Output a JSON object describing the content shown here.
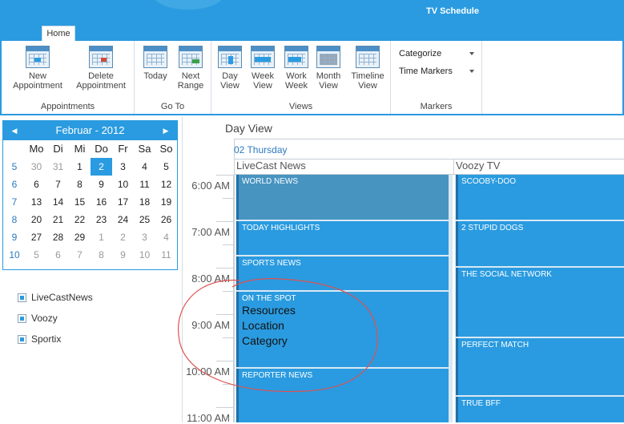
{
  "window": {
    "title": "TV Schedule"
  },
  "ribbon": {
    "tabs": [
      {
        "label": "Home"
      }
    ],
    "groups": [
      {
        "label": "Appointments",
        "buttons": [
          {
            "label": "New\nAppointment",
            "icon": "calendar-new-icon"
          },
          {
            "label": "Delete\nAppointment",
            "icon": "calendar-delete-icon"
          }
        ]
      },
      {
        "label": "Go To",
        "buttons": [
          {
            "label": "Today",
            "icon": "calendar-today-icon"
          },
          {
            "label": "Next\nRange",
            "icon": "calendar-next-icon"
          }
        ]
      },
      {
        "label": "Views",
        "buttons": [
          {
            "label": "Day\nView",
            "icon": "day-view-icon"
          },
          {
            "label": "Week\nView",
            "icon": "week-view-icon"
          },
          {
            "label": "Work\nWeek",
            "icon": "work-week-icon"
          },
          {
            "label": "Month\nView",
            "icon": "month-view-icon"
          },
          {
            "label": "Timeline\nView",
            "icon": "timeline-view-icon"
          }
        ]
      },
      {
        "label": "Markers",
        "dropdowns": [
          {
            "label": "Categorize"
          },
          {
            "label": "Time Markers"
          }
        ]
      }
    ]
  },
  "minicalendar": {
    "month_label": "Februar - 2012",
    "weekday_headers": [
      "Mo",
      "Di",
      "Mi",
      "Do",
      "Fr",
      "Sa",
      "So"
    ],
    "weeks": [
      {
        "week": "5",
        "days": [
          "30",
          "31",
          "1",
          "2",
          "3",
          "4",
          "5"
        ]
      },
      {
        "week": "6",
        "days": [
          "6",
          "7",
          "8",
          "9",
          "10",
          "11",
          "12"
        ]
      },
      {
        "week": "7",
        "days": [
          "13",
          "14",
          "15",
          "16",
          "17",
          "18",
          "19"
        ]
      },
      {
        "week": "8",
        "days": [
          "20",
          "21",
          "22",
          "23",
          "24",
          "25",
          "26"
        ]
      },
      {
        "week": "9",
        "days": [
          "27",
          "28",
          "29",
          "1",
          "2",
          "3",
          "4"
        ]
      },
      {
        "week": "10",
        "days": [
          "5",
          "6",
          "7",
          "8",
          "9",
          "10",
          "11"
        ]
      }
    ],
    "selected_day": "2"
  },
  "resources": [
    "LiveCastNews",
    "Voozy",
    "Sportix"
  ],
  "scheduler": {
    "view_title": "Day View",
    "date_header": "02 Thursday",
    "resource_headers": [
      "LiveCast News",
      "Voozy TV"
    ],
    "time_labels": [
      "6:00 AM",
      "7:00 AM",
      "8:00 AM",
      "9:00 AM",
      "10:00 AM",
      "11:00 AM"
    ],
    "livecast_appointments": [
      {
        "title": "WORLD NEWS"
      },
      {
        "title": "TODAY HIGHLIGHTS"
      },
      {
        "title": "SPORTS NEWS"
      },
      {
        "title": "ON THE SPOT",
        "details": [
          "Resources",
          "Location",
          "Category"
        ]
      },
      {
        "title": "REPORTER NEWS"
      }
    ],
    "voozy_appointments": [
      {
        "title": "SCOOBY-DOO"
      },
      {
        "title": "2 STUPID DOGS"
      },
      {
        "title": "THE SOCIAL NETWORK"
      },
      {
        "title": "PERFECT MATCH"
      },
      {
        "title": "TRUE BFF"
      }
    ]
  },
  "colors": {
    "accent": "#2a9be0",
    "annotation": "#e05050"
  }
}
